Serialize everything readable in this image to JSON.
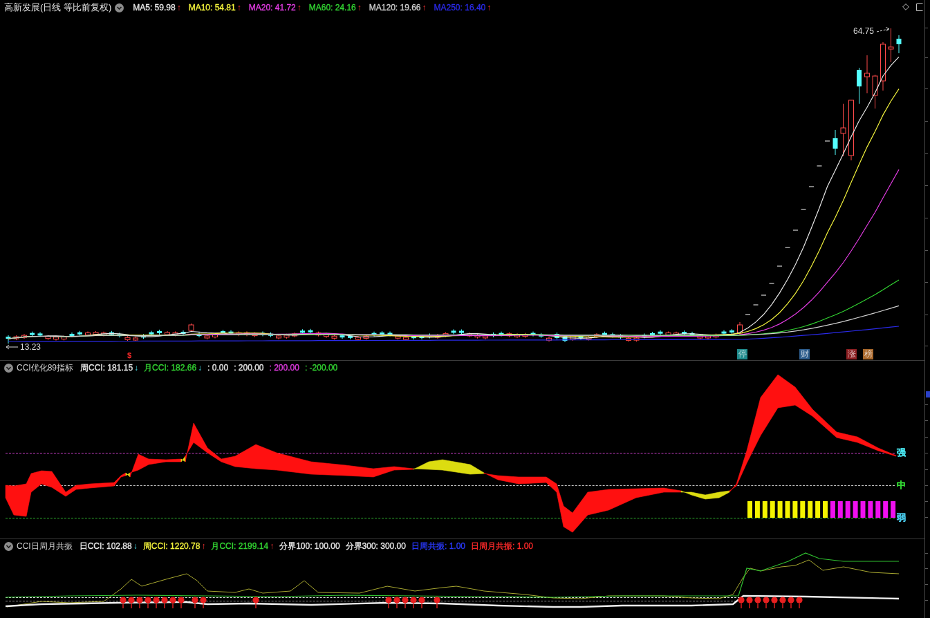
{
  "main_panel": {
    "title": "高新发展(日线 等比前复权)",
    "legend": [
      {
        "label": "MA5: 59.98",
        "color": "#e6e6e6",
        "arrow": "↑",
        "rising": true
      },
      {
        "label": "MA10: 54.81",
        "color": "#f2f23c",
        "arrow": "↑",
        "rising": true
      },
      {
        "label": "MA20: 41.72",
        "color": "#e23ce2",
        "arrow": "↑",
        "rising": true
      },
      {
        "label": "MA60: 24.16",
        "color": "#32d432",
        "arrow": "↑",
        "rising": true
      },
      {
        "label": "MA120: 19.66",
        "color": "#cfcfcf",
        "arrow": "↑",
        "rising": true
      },
      {
        "label": "MA250: 16.40",
        "color": "#2a2ae8",
        "arrow": "↑",
        "rising": true
      }
    ],
    "high_label": "64.75",
    "low_label": "13.23",
    "signal_mark": "$",
    "event_tags": [
      {
        "text": "停",
        "color": "#1f8a8c"
      },
      {
        "text": "财",
        "color": "#2c5c8c"
      },
      {
        "text": "涨",
        "color": "#8c1f22"
      },
      {
        "text": "榜",
        "color": "#a8672a"
      }
    ]
  },
  "cci_panel": {
    "title": "CCI优化89指标",
    "legend": [
      {
        "label": "周CCI: 181.15",
        "color": "#e6e6e6",
        "arrow": "↓",
        "rising": false
      },
      {
        "label": "月CCI: 182.66",
        "color": "#32d432",
        "arrow": "↓",
        "rising": false
      },
      {
        "label": ": 0.00",
        "color": "#e6e6e6"
      },
      {
        "label": ": 200.00",
        "color": "#e6e6e6"
      },
      {
        "label": ": 200.00",
        "color": "#e23ce2"
      },
      {
        "label": ": -200.00",
        "color": "#32d432"
      }
    ],
    "level_labels": [
      {
        "text": "强",
        "color": "#48e4ee"
      },
      {
        "text": "中",
        "color": "#32d432"
      },
      {
        "text": "弱",
        "color": "#48c8e8"
      }
    ]
  },
  "resonance_panel": {
    "title": "CCI日周月共振",
    "legend": [
      {
        "label": "日CCI: 102.88",
        "color": "#e6e6e6",
        "arrow": "↓",
        "rising": false
      },
      {
        "label": "周CCI: 1220.78",
        "color": "#f2f23c",
        "arrow": "↑",
        "rising": true
      },
      {
        "label": "月CCI: 2199.14",
        "color": "#32d432",
        "arrow": "↑",
        "rising": true
      },
      {
        "label": "分界100: 100.00",
        "color": "#e6e6e6"
      },
      {
        "label": "分界300: 300.00",
        "color": "#e6e6e6"
      },
      {
        "label": "日周共振: 1.00",
        "color": "#2a3aff"
      },
      {
        "label": "日周月共振: 1.00",
        "color": "#ff2a2a"
      }
    ]
  }
}
